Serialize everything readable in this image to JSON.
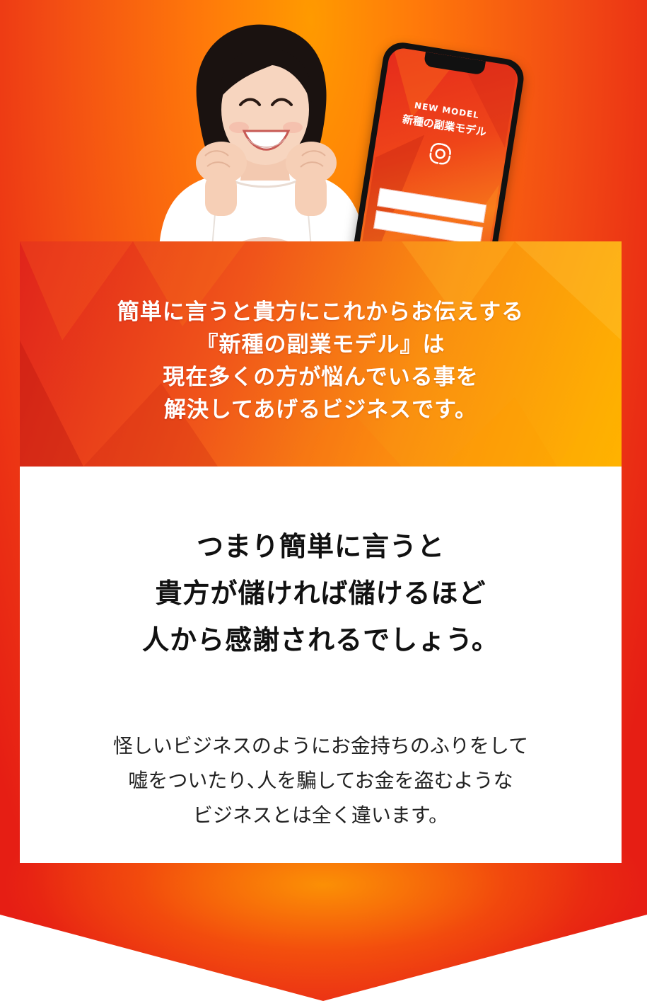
{
  "phone": {
    "kicker": "NEW MODEL",
    "title": "新種の副業モデル",
    "logo_icon": "swirl-logo-icon"
  },
  "intro": {
    "lines": [
      "簡単に言うと貴方にこれからお伝えする",
      "『新種の副業モデル』は",
      "現在多くの方が悩んでいる事を",
      "解決してあげるビジネスです。"
    ]
  },
  "headline": {
    "lines": [
      "つまり簡単に言うと",
      "貴方が儲ければ儲けるほど",
      "人から感謝されるでしょう。"
    ]
  },
  "body": {
    "lines": [
      "怪しいビジネスのようにお金持ちのふりをして",
      "嘘をついたり､人を騙してお金を盗むような",
      "ビジネスとは全く違います。"
    ]
  },
  "colors": {
    "accent_red": "#e61e14",
    "accent_orange": "#ff8a00",
    "accent_yellow": "#ffb400",
    "text_dark": "#111111"
  }
}
